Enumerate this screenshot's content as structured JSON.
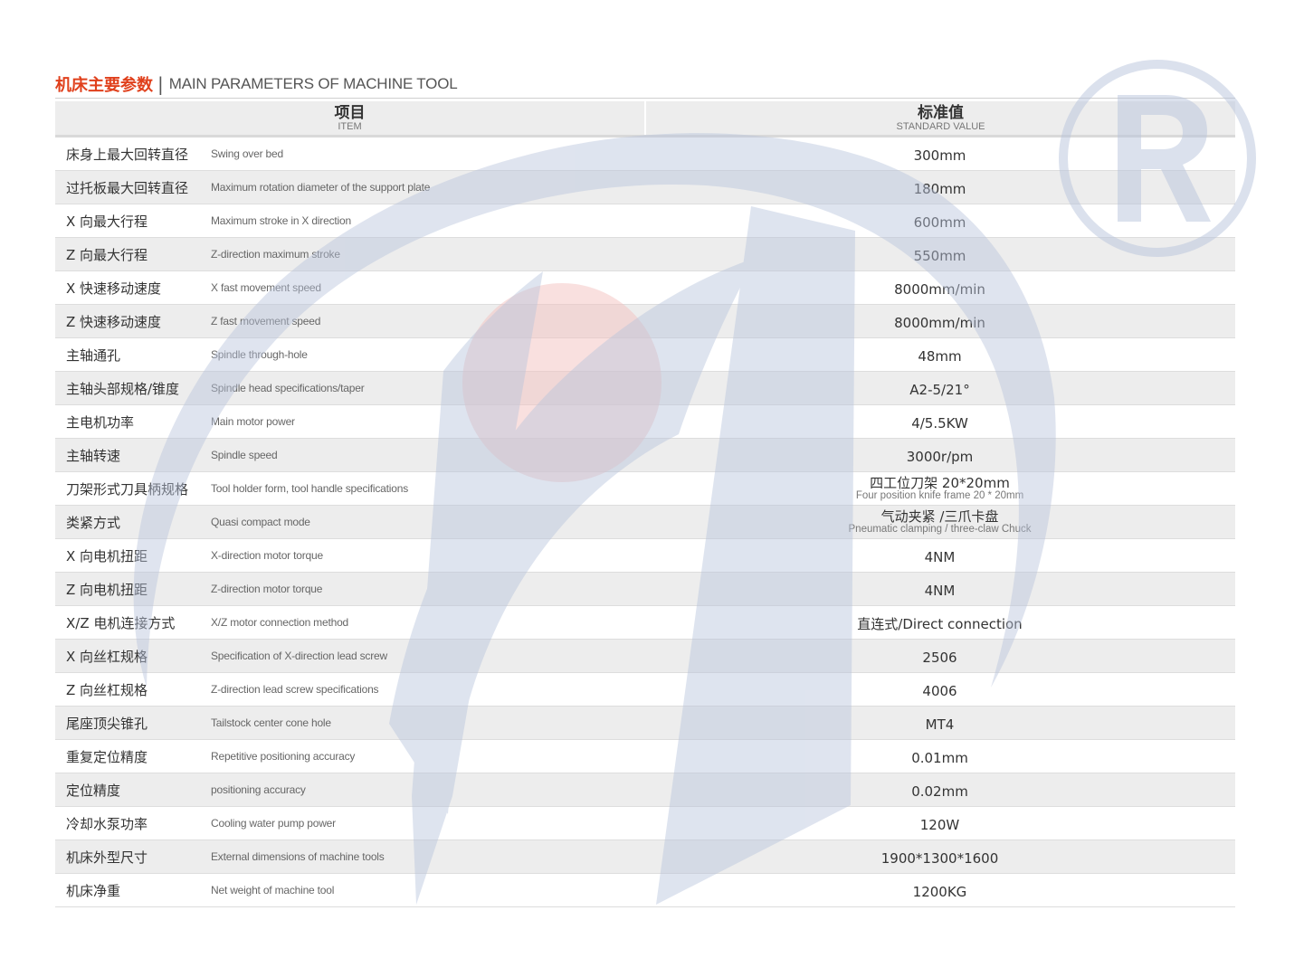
{
  "header": {
    "title_cn": "机床主要参数",
    "separator": "|",
    "title_en": "MAIN PARAMETERS OF MACHINE TOOL"
  },
  "table": {
    "col_item_cn": "项目",
    "col_item_en": "ITEM",
    "col_value_cn": "标准值",
    "col_value_en": "STANDARD VALUE",
    "rows": [
      {
        "cn": "床身上最大回转直径",
        "en": "Swing over bed",
        "value": "300mm"
      },
      {
        "cn": "过托板最大回转直径",
        "en": "Maximum rotation diameter of the support plate",
        "value": "180mm"
      },
      {
        "cn": "X 向最大行程",
        "en": "Maximum stroke in X direction",
        "value": "600mm"
      },
      {
        "cn": "Z 向最大行程",
        "en": "Z-direction maximum stroke",
        "value": "550mm"
      },
      {
        "cn": "X 快速移动速度",
        "en": "X fast movement speed",
        "value": "8000mm/min"
      },
      {
        "cn": "Z 快速移动速度",
        "en": "Z fast movement speed",
        "value": "8000mm/min"
      },
      {
        "cn": "主轴通孔",
        "en": "Spindle through-hole",
        "value": "48mm"
      },
      {
        "cn": "主轴头部规格/锥度",
        "en": "Spindle head specifications/taper",
        "value": "A2-5/21°"
      },
      {
        "cn": "主电机功率",
        "en": "Main motor power",
        "value": "4/5.5KW"
      },
      {
        "cn": "主轴转速",
        "en": "Spindle speed",
        "value": "3000r/pm"
      },
      {
        "cn": "刀架形式刀具柄规格",
        "en": "Tool holder form, tool handle specifications",
        "value": "四工位刀架 20*20mm",
        "value_sub": "Four position knife frame 20 * 20mm"
      },
      {
        "cn": "类紧方式",
        "en": "Quasi compact mode",
        "value": "气动夹紧 /三爪卡盘",
        "value_sub": "Pneumatic clamping / three-claw Chuck"
      },
      {
        "cn": "X 向电机扭距",
        "en": "X-direction motor torque",
        "value": "4NM"
      },
      {
        "cn": "Z 向电机扭距",
        "en": "Z-direction motor torque",
        "value": "4NM"
      },
      {
        "cn": "X/Z 电机连接方式",
        "en": "X/Z motor connection method",
        "value": "直连式/Direct connection"
      },
      {
        "cn": "X 向丝杠规格",
        "en": "Specification of X-direction lead screw",
        "value": "2506"
      },
      {
        "cn": "Z 向丝杠规格",
        "en": "Z-direction lead screw specifications",
        "value": "4006"
      },
      {
        "cn": "尾座顶尖锥孔",
        "en": "Tailstock center cone hole",
        "value": "MT4"
      },
      {
        "cn": "重复定位精度",
        "en": "Repetitive positioning accuracy",
        "value": "0.01mm"
      },
      {
        "cn": "定位精度",
        "en": "positioning accuracy",
        "value": "0.02mm"
      },
      {
        "cn": "冷却水泵功率",
        "en": "Cooling water pump power",
        "value": "120W"
      },
      {
        "cn": "机床外型尺寸",
        "en": "External dimensions of machine tools",
        "value": "1900*1300*1600"
      },
      {
        "cn": "机床净重",
        "en": "Net weight of machine tool",
        "value": "1200KG"
      }
    ]
  },
  "colors": {
    "accent": "#e0401c",
    "watermark_blue": "#b8c4dc",
    "watermark_red": "#f3c2bf",
    "row_alt": "#ededed"
  }
}
